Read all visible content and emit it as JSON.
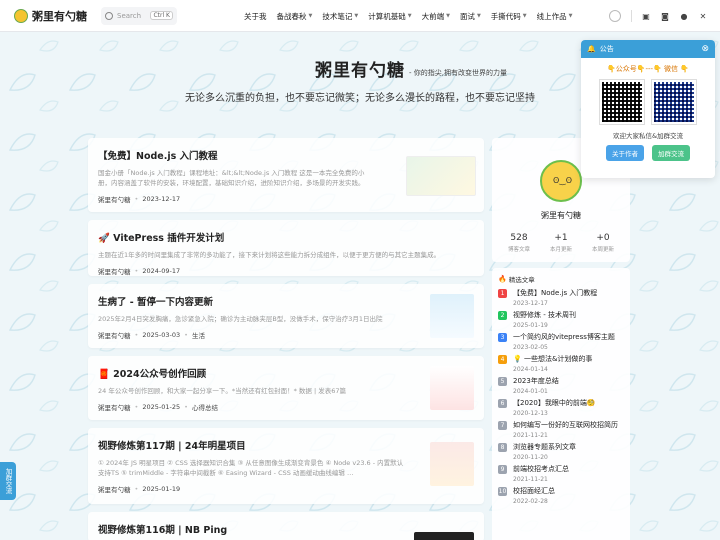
{
  "brand": {
    "name": "粥里有勺糖"
  },
  "search": {
    "placeholder": "Search",
    "shortcut": "Ctrl K"
  },
  "nav": {
    "items": [
      {
        "label": "关于我",
        "dropdown": false
      },
      {
        "label": "备战春秋",
        "dropdown": true
      },
      {
        "label": "技术笔记",
        "dropdown": true
      },
      {
        "label": "计算机基础",
        "dropdown": true
      },
      {
        "label": "大前端",
        "dropdown": true
      },
      {
        "label": "面试",
        "dropdown": true
      },
      {
        "label": "手撕代码",
        "dropdown": true
      },
      {
        "label": "线上作品",
        "dropdown": true
      }
    ],
    "icons": [
      "theme-toggle-icon",
      "card-icon",
      "rss-icon",
      "github-icon",
      "x-icon"
    ]
  },
  "hero": {
    "title": "粥里有勺糖",
    "tagline": "- 你的指尖,拥有改变世界的力量",
    "slogan": "无论多么沉重的负担，也不要忘记微笑；无论多么漫长的路程，也不要忘记坚持"
  },
  "posts": [
    {
      "title": "【免费】Node.js 入门教程",
      "desc": "国金小册「Node.js 入门教程」课程地址：&lt;&lt;Node.js 入门教程 这是一本完全免费的小册，内容涵盖了软件的安装，环境配置，基础知识介绍，进阶知识介绍，多场景的开发实践。Nod",
      "author": "粥里有勺糖",
      "date": "2023-12-17",
      "tag": ""
    },
    {
      "title": "🚀 VitePress 插件开发计划",
      "desc": "主题在近1年多的时间里集成了非常的多功能了，接下来计划将这些能力拆分成组件，以便于更方便的与其它主题集成。",
      "author": "粥里有勺糖",
      "date": "2024-09-17",
      "tag": ""
    },
    {
      "title": "生病了 - 暂停一下内容更新",
      "desc": "2025年2月4日突发胸痛，急诊紧急入院；确诊为主动脉夹层B型，没做手术，保守治疗3月1日出院",
      "author": "粥里有勺糖",
      "date": "2025-03-03",
      "tag": "生活"
    },
    {
      "title": "🧧 2024公众号创作回顾",
      "desc": "24 年公众号创作回顾，和大家一起分享一下。*当然还有红包封面！* 数据 | 发表67篇",
      "author": "粥里有勺糖",
      "date": "2025-01-25",
      "tag": "心得总结"
    },
    {
      "title": "视野修炼第117期 | 24年明星项目",
      "desc": "① 2024年 JS 明星项目 ② CSS 选择器知识合集 ③ 从任意图像生成渐变背景色 ④ Node v23.6 - 内置默认支持TS ⑤ trimMiddle - 字符串中间截断 ⑥ Easing Wizard - CSS 动画缓动曲线编辑 …",
      "author": "粥里有勺糖",
      "date": "2025-01-19",
      "tag": ""
    },
    {
      "title": "视野修炼第116期 | NB Ping",
      "desc": "",
      "author": "",
      "date": "",
      "tag": ""
    }
  ],
  "profile": {
    "name": "粥里有勺糖",
    "stats": [
      {
        "value": "528",
        "label": "博客文章"
      },
      {
        "value": "+1",
        "label": "本月更新"
      },
      {
        "value": "+0",
        "label": "本周更新"
      }
    ]
  },
  "featured": {
    "heading": "精选文章",
    "items": [
      {
        "rank": "1",
        "title": "【免费】Node.js 入门教程",
        "date": "2023-12-17"
      },
      {
        "rank": "2",
        "title": "视野修炼 - 技术周刊",
        "date": "2025-01-19"
      },
      {
        "rank": "3",
        "title": "一个简约风的vitepress博客主题",
        "date": "2023-02-05"
      },
      {
        "rank": "4",
        "title": "💡 一些想法&计划做的事",
        "date": "2024-01-14"
      },
      {
        "rank": "5",
        "title": "2023年度总结",
        "date": "2024-01-01"
      },
      {
        "rank": "6",
        "title": "【2020】我眼中的前端🧐",
        "date": "2020-12-13"
      },
      {
        "rank": "7",
        "title": "如何编写一份好的互联网校招简历",
        "date": "2021-11-21"
      },
      {
        "rank": "8",
        "title": "浏览器专题系列文章",
        "date": "2020-11-20"
      },
      {
        "rank": "9",
        "title": "前端校招考点汇总",
        "date": "2021-11-21"
      },
      {
        "rank": "10",
        "title": "校招面经汇总",
        "date": "2022-02-28"
      }
    ],
    "rank_colors": [
      "#ef4444",
      "#22c55e",
      "#3b82f6",
      "#f59e0b",
      "#9ca3af",
      "#9ca3af",
      "#9ca3af",
      "#9ca3af",
      "#9ca3af",
      "#9ca3af"
    ]
  },
  "notice": {
    "heading": "公告",
    "subtitle": "👇公众号👇---👇 微信 👇",
    "text": "欢迎大家私信&加群交流",
    "btn_author": "关于作者",
    "btn_group": "加群交流"
  },
  "side_tab": {
    "label": "加群交流"
  },
  "colors": {
    "accent": "#3b9fd8",
    "green": "#4cc38a"
  }
}
